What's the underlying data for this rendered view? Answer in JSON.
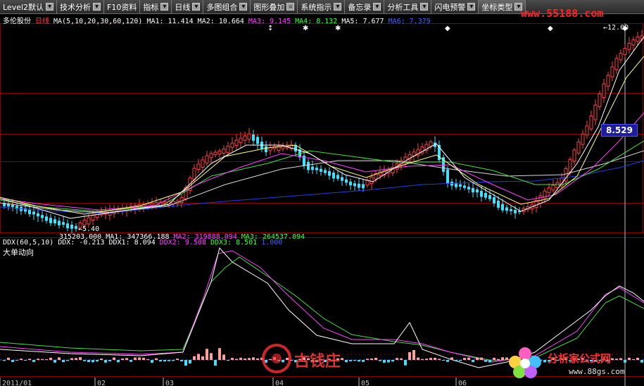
{
  "toolbar": {
    "items": [
      {
        "label": "Level2默认"
      },
      {
        "label": "技术分析"
      },
      {
        "label": "F10资料"
      },
      {
        "label": "指标"
      },
      {
        "label": "日线"
      },
      {
        "label": "多图组合"
      },
      {
        "label": "图形叠加"
      },
      {
        "label": "系统指示"
      },
      {
        "label": "备忘录"
      },
      {
        "label": "分析工具"
      },
      {
        "label": "闪电预警"
      },
      {
        "label": "坐标类型"
      }
    ],
    "watermark": "www.55188.com"
  },
  "stock": {
    "name": "多伦股份",
    "period": "日线",
    "ma_params": "MA(5,10,20,30,60,120)",
    "ma": [
      {
        "text": "MA1: 11.414",
        "color": "#ffffff"
      },
      {
        "text": "MA2: 10.664",
        "color": "#ffffff"
      },
      {
        "text": "MA3: 9.145",
        "color": "#ff40ff"
      },
      {
        "text": "MA4: 8.132",
        "color": "#40ff40"
      },
      {
        "text": "MA5: 7.677",
        "color": "#ffffff"
      },
      {
        "text": "MA6: 7.379",
        "color": "#4060ff"
      }
    ],
    "high_label": "12.00",
    "low_label": "5.40",
    "price_tag": "8.529"
  },
  "volume_info": {
    "items": [
      {
        "text": "315203.000",
        "color": "#ffffff"
      },
      {
        "text": "MA1: 347366.188",
        "color": "#ffffff"
      },
      {
        "text": "MA2: 319888.094",
        "color": "#ff40ff"
      },
      {
        "text": "MA3: 264537.094",
        "color": "#40ff40"
      }
    ]
  },
  "ddx": {
    "params": "DDX(60,5,10)",
    "items": [
      {
        "text": "DDX: -0.213",
        "color": "#ffffff"
      },
      {
        "text": "DDX1: 8.094",
        "color": "#ffffff"
      },
      {
        "text": "DDX2: 9.508",
        "color": "#ff40ff"
      },
      {
        "text": "DDX3: 8.501",
        "color": "#40ff40"
      },
      {
        "text": "1.000",
        "color": "#4060ff"
      }
    ],
    "title": "大单动向"
  },
  "x_axis": {
    "labels": [
      "2011/01",
      "02",
      "03",
      "04",
      "05",
      "06"
    ]
  },
  "branding": {
    "brand1": "古钱庄",
    "brand2": "分析家公式网",
    "brand2_url": "www.88gs.com"
  },
  "colors": {
    "up": "#ff4040",
    "down": "#40e0ff",
    "grid": "#7a0000",
    "ma1": "#ffffff",
    "ma2": "#ffff80",
    "ma3": "#ff40ff",
    "ma4": "#40ff40",
    "ma6": "#3050ff"
  }
}
